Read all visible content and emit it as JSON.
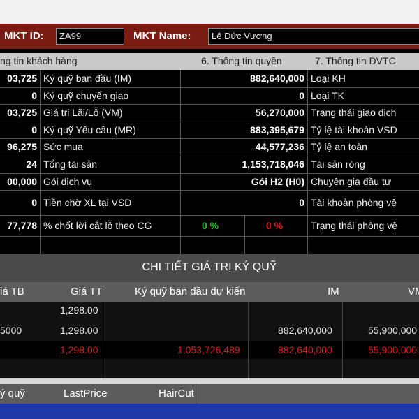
{
  "header": {
    "mkt_id_label": "MKT ID:",
    "mkt_id_value": "ZA99",
    "mkt_name_label": "MKT Name:",
    "mkt_name_value": "Lê Đức Vương"
  },
  "tabs": [
    {
      "label": "ng tin khách hàng"
    },
    {
      "label": "6. Thông tin quyền"
    },
    {
      "label": "7. Thông tin DVTC"
    }
  ],
  "info_rows": [
    {
      "left_value": "03,725",
      "label": "Ký quỹ ban đầu (IM)",
      "value": "882,640,000",
      "right_label": "Loại KH"
    },
    {
      "left_value": "0",
      "label": "Ký quỹ chuyển giao",
      "value": "0",
      "right_label": "Loại TK"
    },
    {
      "left_value": "03,725",
      "label": "Giá trị Lãi/Lỗ (VM)",
      "value": "56,270,000",
      "right_label": "Trạng thái giao dịch"
    },
    {
      "left_value": "0",
      "label": "Ký quỹ Yêu cầu (MR)",
      "value": "883,395,679",
      "right_label": "Tỷ lệ tài khoản VSD"
    },
    {
      "left_value": "96,275",
      "label": "Sức mua",
      "value": "44,577,236",
      "right_label": "Tỷ lệ an toàn"
    },
    {
      "left_value": "24",
      "label": "Tổng tài sản",
      "value": "1,153,718,046",
      "right_label": "Tài sản ròng"
    },
    {
      "left_value": "00,000",
      "label": "Gói dịch vụ",
      "value": "Gói H2 (H0)",
      "right_label": "Chuyên gia đầu tư"
    },
    {
      "left_value": "0",
      "label": "Tiền chờ XL tại VSD",
      "value": "0",
      "right_label": "Tài khoản phòng vệ"
    },
    {
      "left_value": "77,778",
      "label": "% chốt lời cắt lỗ theo CG",
      "value_green": "0 %",
      "value_red": "0 %",
      "right_label": "Trạng thái phòng vệ"
    }
  ],
  "margin_section": {
    "title": "CHI TIẾT GIÁ TRỊ KÝ QUỸ",
    "headers": [
      "iá TB",
      "Giá TT",
      "Ký quỹ ban đầu dự kiến",
      "IM",
      "VM"
    ],
    "rows": [
      {
        "avg": "",
        "price": "1,298.00",
        "initial": "",
        "im": "",
        "vm": ""
      },
      {
        "avg": "5000",
        "price": "1,298.00",
        "initial": "",
        "im": "882,640,000",
        "vm": "55,900,000"
      },
      {
        "avg": "",
        "price": "1,298.00",
        "initial": "1,053,726,489",
        "im": "882,640,000",
        "vm": "55,900,000"
      }
    ]
  },
  "bottom": {
    "headers": [
      "ý quỹ",
      "LastPrice",
      "HairCut"
    ]
  }
}
